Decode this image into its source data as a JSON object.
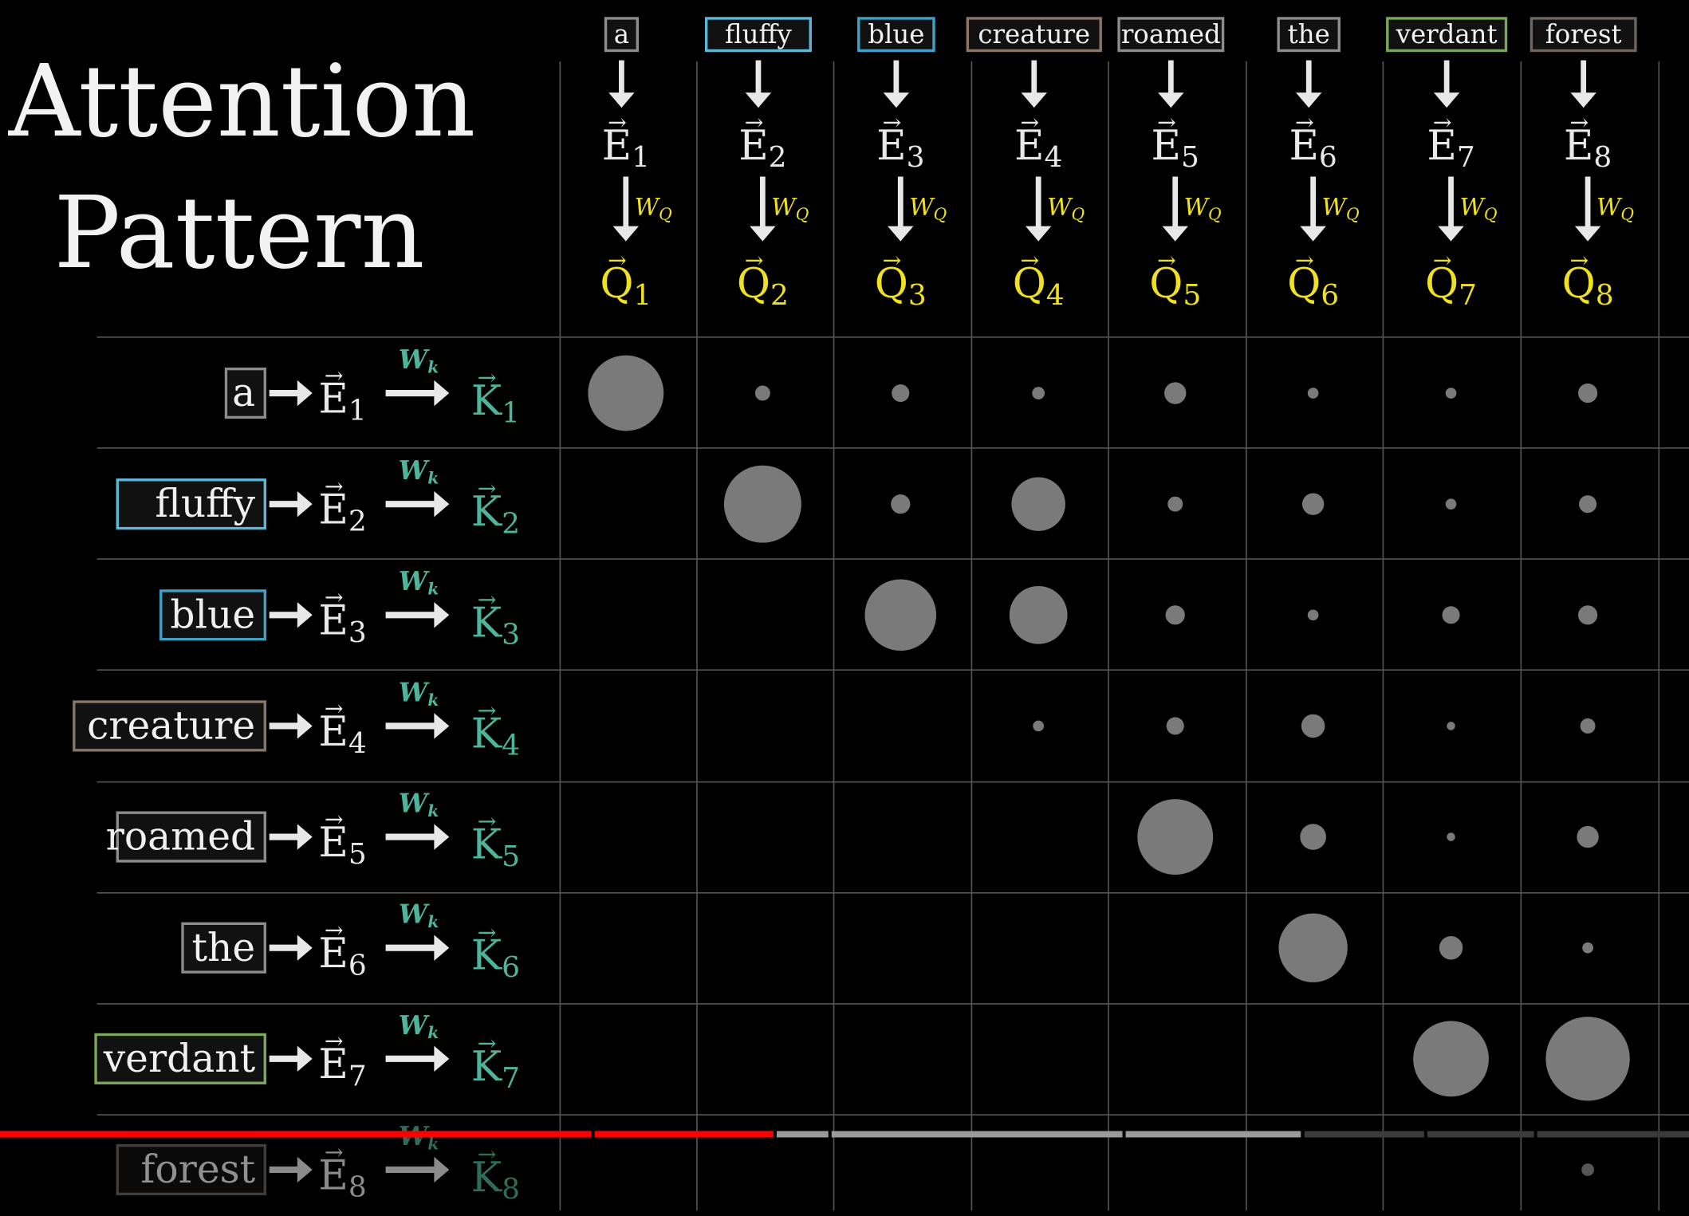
{
  "title": {
    "line1": "Attention",
    "line2": "Pattern"
  },
  "words": [
    {
      "text": "a",
      "color": "#8c8c8c"
    },
    {
      "text": "fluffy",
      "color": "#5cb8d6"
    },
    {
      "text": "blue",
      "color": "#3fa0c8"
    },
    {
      "text": "creature",
      "color": "#8a7566"
    },
    {
      "text": "roamed",
      "color": "#8c8c8c"
    },
    {
      "text": "the",
      "color": "#8c8c8c"
    },
    {
      "text": "verdant",
      "color": "#7aa85a"
    },
    {
      "text": "forest",
      "color": "#6e665e"
    }
  ],
  "symbols": {
    "embedding": "E",
    "query": "Q",
    "key": "K",
    "query_matrix": "W",
    "query_matrix_sub": "Q",
    "key_matrix": "W",
    "key_matrix_sub": "k",
    "subscripts": [
      "1",
      "2",
      "3",
      "4",
      "5",
      "6",
      "7",
      "8"
    ]
  },
  "colors": {
    "query": "#f0e020",
    "key": "#4fb49c",
    "grid": "#555555",
    "dot": "#7a7a7a",
    "played": "#ff0000",
    "buffered": "#9a9a9a",
    "unbuffered": "#3a3a3a"
  },
  "attention_weights": [
    [
      0.9,
      0.18,
      0.21,
      0.15,
      0.26,
      0.13,
      0.13,
      0.23
    ],
    [
      null,
      0.92,
      0.23,
      0.64,
      0.18,
      0.26,
      0.13,
      0.21
    ],
    [
      null,
      null,
      0.85,
      0.69,
      0.23,
      0.13,
      0.21,
      0.23
    ],
    [
      null,
      null,
      null,
      0.13,
      0.21,
      0.28,
      0.1,
      0.18
    ],
    [
      null,
      null,
      null,
      null,
      0.9,
      0.31,
      0.1,
      0.26
    ],
    [
      null,
      null,
      null,
      null,
      null,
      0.82,
      0.28,
      0.13
    ],
    [
      null,
      null,
      null,
      null,
      null,
      null,
      0.9,
      1.0
    ],
    [
      null,
      null,
      null,
      null,
      null,
      null,
      null,
      0.15
    ]
  ],
  "video_progress": {
    "played_fraction": 0.458,
    "buffered_fraction": 0.77
  }
}
